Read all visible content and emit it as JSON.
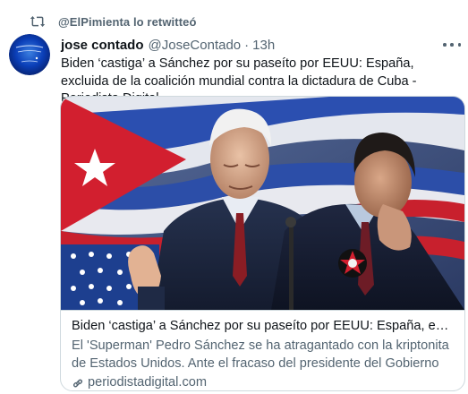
{
  "retweet": {
    "icon": "retweet-icon",
    "text": "@ElPimienta lo retwitteó"
  },
  "author": {
    "avatar": "avatar",
    "avatar_text": "Mundo Ines Holy Amor Merecido",
    "name": "jose contado",
    "handle": "@JoseContado",
    "separator": "·",
    "time": "13h"
  },
  "more_icon": "more-icon",
  "tweet": {
    "text": "Biden ‘castiga’ a Sánchez por su paseíto por EEUU: España, excluida de la coalición mundial contra la dictadura de Cuba - Periodista Digital"
  },
  "card": {
    "image": "news-photo",
    "title": "Biden ‘castiga’ a Sánchez por su paseíto por EEUU: España, excluida de la coalición mundial contra la dictadura de Cuba - Periodista Digital",
    "description": "El 'Superman' Pedro Sánchez se ha atragantado con la kriptonita de Estados Unidos. Ante el fracaso del presidente del Gobierno por tener una foto con Joe Biden...",
    "domain_icon": "link-icon",
    "domain": "periodistadigital.com"
  },
  "colors": {
    "text_primary": "#0f1419",
    "text_secondary": "#536471",
    "border": "#cfd9de",
    "flag_red": "#d21f2f",
    "flag_blue": "#1b3a8a"
  }
}
